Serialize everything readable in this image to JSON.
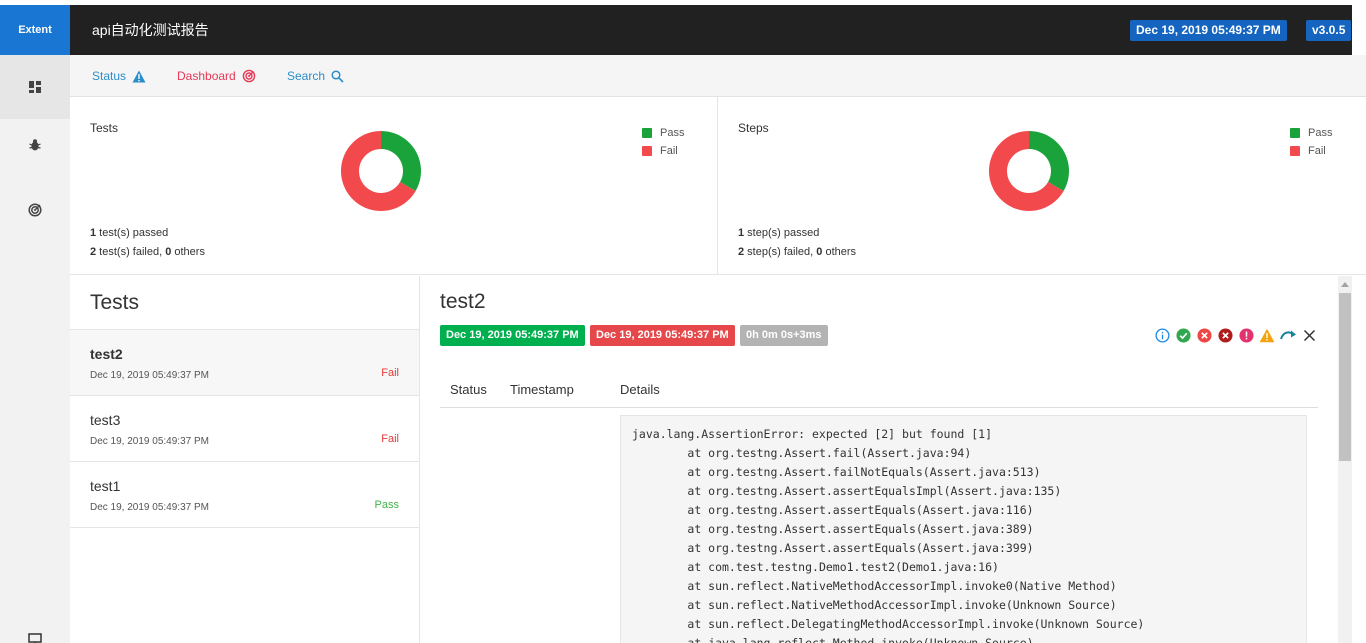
{
  "header": {
    "brand": "Extent",
    "title": "api自动化测试报告",
    "date_badge": "Dec 19, 2019 05:49:37 PM",
    "version_badge": "v3.0.5"
  },
  "sidebar": {
    "items": [
      {
        "icon": "dashboard-icon",
        "active": true
      },
      {
        "icon": "bug-icon",
        "active": false
      },
      {
        "icon": "target-icon",
        "active": false
      },
      {
        "icon": "monitor-icon",
        "active": false
      }
    ]
  },
  "subnav": {
    "status_label": "Status",
    "dashboard_label": "Dashboard",
    "search_label": "Search"
  },
  "colors": {
    "pass": "#1aa33a",
    "fail": "#f2494c",
    "brand": "#1976d2",
    "header": "#212121"
  },
  "panels": {
    "tests": {
      "title": "Tests",
      "legend_pass": "Pass",
      "legend_fail": "Fail",
      "passed_count": "1",
      "passed_text": " test(s) passed",
      "failed_count": "2",
      "failed_text": " test(s) failed, ",
      "others_count": "0",
      "others_text": " others",
      "pass": 1,
      "fail": 2
    },
    "steps": {
      "title": "Steps",
      "legend_pass": "Pass",
      "legend_fail": "Fail",
      "passed_count": "1",
      "passed_text": " step(s) passed",
      "failed_count": "2",
      "failed_text": " step(s) failed, ",
      "others_count": "0",
      "others_text": " others",
      "pass": 1,
      "fail": 2
    }
  },
  "tests_list": {
    "heading": "Tests",
    "items": [
      {
        "name": "test2",
        "time": "Dec 19, 2019 05:49:37 PM",
        "status": "Fail"
      },
      {
        "name": "test3",
        "time": "Dec 19, 2019 05:49:37 PM",
        "status": "Fail"
      },
      {
        "name": "test1",
        "time": "Dec 19, 2019 05:49:37 PM",
        "status": "Pass"
      }
    ]
  },
  "detail": {
    "title": "test2",
    "start_time": "Dec 19, 2019 05:49:37 PM",
    "end_time": "Dec 19, 2019 05:49:37 PM",
    "duration": "0h 0m 0s+3ms",
    "columns": {
      "status": "Status",
      "timestamp": "Timestamp",
      "details": "Details"
    },
    "status_icons": [
      "info-icon",
      "pass-icon",
      "fail-icon",
      "fatal-icon",
      "error-icon",
      "warning-icon",
      "skip-icon",
      "clear-filter-icon"
    ],
    "stack_trace": [
      "java.lang.AssertionError: expected [2] but found [1]",
      "\tat org.testng.Assert.fail(Assert.java:94)",
      "\tat org.testng.Assert.failNotEquals(Assert.java:513)",
      "\tat org.testng.Assert.assertEqualsImpl(Assert.java:135)",
      "\tat org.testng.Assert.assertEquals(Assert.java:116)",
      "\tat org.testng.Assert.assertEquals(Assert.java:389)",
      "\tat org.testng.Assert.assertEquals(Assert.java:399)",
      "\tat com.test.testng.Demo1.test2(Demo1.java:16)",
      "\tat sun.reflect.NativeMethodAccessorImpl.invoke0(Native Method)",
      "\tat sun.reflect.NativeMethodAccessorImpl.invoke(Unknown Source)",
      "\tat sun.reflect.DelegatingMethodAccessorImpl.invoke(Unknown Source)",
      "\tat java.lang.reflect.Method.invoke(Unknown Source)"
    ]
  }
}
